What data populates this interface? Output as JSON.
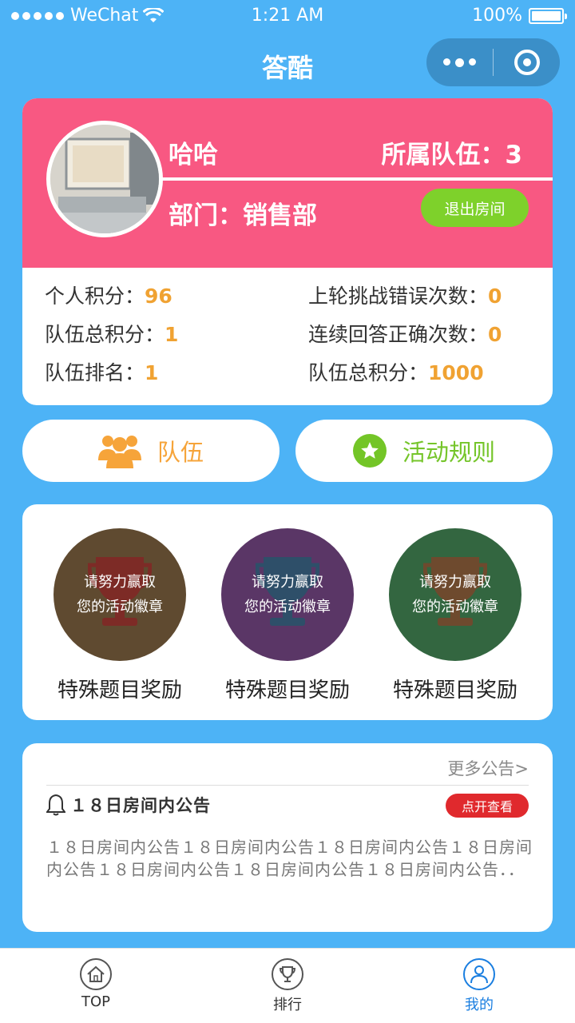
{
  "status_bar": {
    "carrier": "WeChat",
    "time": "1:21 AM",
    "battery": "100%",
    "battery_level": 1.0
  },
  "nav": {
    "title": "答酷"
  },
  "profile": {
    "name": "哈哈",
    "team_label": "所属队伍：",
    "team_value": "3",
    "dept_label": "部门：",
    "dept_value": "销售部",
    "exit_button": "退出房间"
  },
  "stats": [
    {
      "label": "个人积分：",
      "value": "96"
    },
    {
      "label": "上轮挑战错误次数：",
      "value": "0"
    },
    {
      "label": "队伍总积分：",
      "value": "1"
    },
    {
      "label": "连续回答正确次数：",
      "value": "0"
    },
    {
      "label": "队伍排名：",
      "value": "1"
    },
    {
      "label": "队伍总积分：",
      "value": "1000"
    }
  ],
  "actions": {
    "team": "队伍",
    "rules": "活动规则"
  },
  "badges": [
    {
      "line1": "请努力赢取",
      "line2": "您的活动徽章",
      "label": "特殊题目奖励",
      "bg": "#5f4a30",
      "cup": "#7d2b26"
    },
    {
      "line1": "请努力赢取",
      "line2": "您的活动徽章",
      "label": "特殊题目奖励",
      "bg": "#5a3666",
      "cup": "#2e4f69"
    },
    {
      "line1": "请努力赢取",
      "line2": "您的活动徽章",
      "label": "特殊题目奖励",
      "bg": "#336640",
      "cup": "#6e4a2e"
    }
  ],
  "notice": {
    "more": "更多公告>",
    "title": "１８日房间内公告",
    "open_button": "点开查看",
    "body": "１８日房间内公告１８日房间内公告１８日房间内公告１８日房间内公告１８日房间内公告１８日房间内公告１８日房间内公告．．"
  },
  "tabs": [
    {
      "label": "TOP",
      "icon": "home-icon"
    },
    {
      "label": "排行",
      "icon": "trophy-icon"
    },
    {
      "label": "我的",
      "icon": "user-icon"
    }
  ],
  "colors": {
    "accent": "#4db3f6",
    "head": "#f85882",
    "value": "#f0a232",
    "green": "#7ed12b",
    "red": "#e0292d",
    "active_tab": "#1a7ee0"
  }
}
